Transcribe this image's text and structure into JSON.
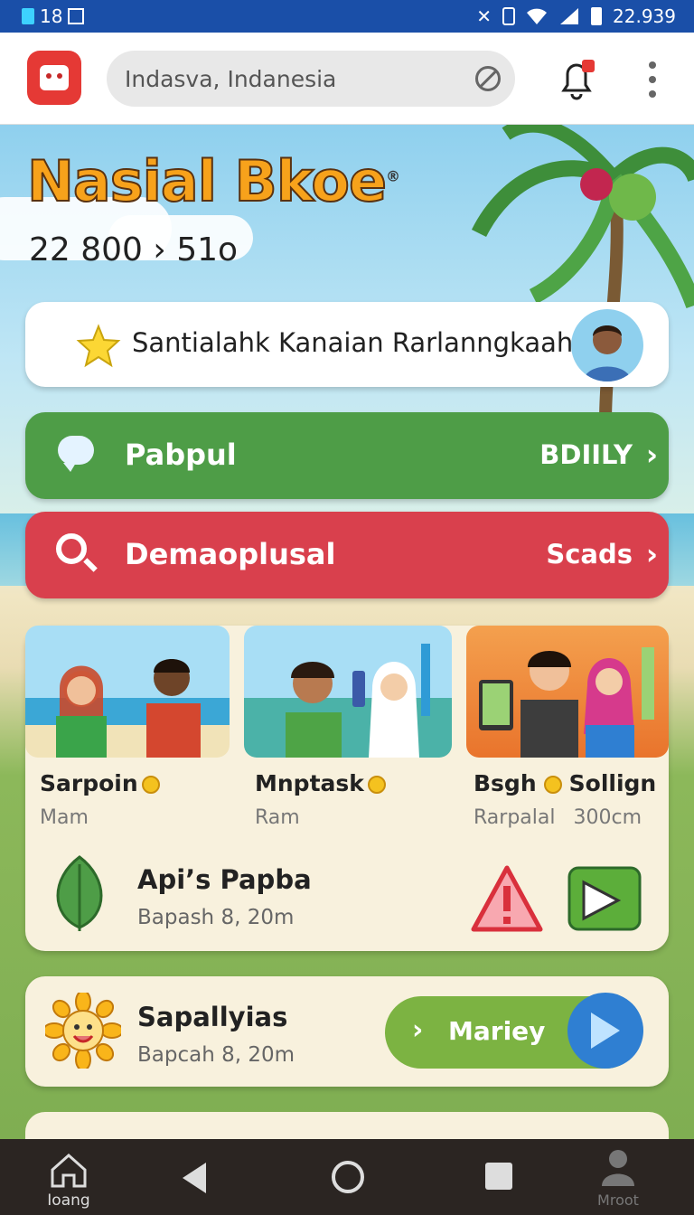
{
  "status_bar": {
    "time": "18",
    "right_text": "22.939"
  },
  "app_bar": {
    "search_value": "Indasva, Indanesia"
  },
  "hero": {
    "brand_title": "Nasial Bkoe",
    "brand_mark": "®",
    "stats": "22 800 › 51o"
  },
  "featured_card": {
    "label": "Santialahk Kanaian Rarlanngkaah"
  },
  "buttons": [
    {
      "label": "Pabpul",
      "action": "BDIILY",
      "color": "#4e9d47"
    },
    {
      "label": "Demaoplusal",
      "action": "Scads",
      "color": "#d9404d"
    }
  ],
  "tiles": [
    {
      "name": "Sarpoin",
      "sub": "Mam"
    },
    {
      "name": "Mnptask",
      "sub": "Ram"
    },
    {
      "name": "Bsgh",
      "name2": "Sollign",
      "sub": "Rarpalal",
      "sub2": "300cm"
    }
  ],
  "list_rows": [
    {
      "title": "Api’s Papba",
      "subtitle": "Bapash 8, 20m"
    },
    {
      "title": "Sapallyias",
      "subtitle": "Bapcah 8, 20m",
      "button": "Mariey"
    }
  ],
  "nav": {
    "home_label": "Ioang",
    "profile_label": "Mroot"
  },
  "colors": {
    "status_bar": "#1a4fa8",
    "green_button": "#4e9d47",
    "red_button": "#d9404d",
    "brand_orange": "#f7a21b",
    "pill_green": "#7cb342"
  }
}
